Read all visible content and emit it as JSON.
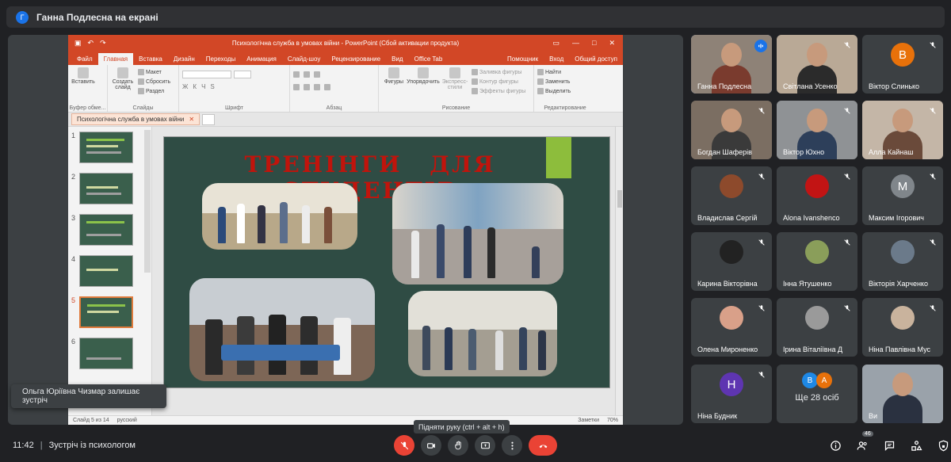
{
  "presenter_bar": {
    "avatar_letter": "Г",
    "text": "Ганна Подлесна на екрані"
  },
  "colors": {
    "accent_blue": "#1a73e8",
    "end_call_red": "#ea4335",
    "ppt_orange": "#d24726",
    "slide_green": "#2f4c44",
    "title_red": "#c0140c"
  },
  "powerpoint": {
    "window_title": "Психологічна служба в умовах війни - PowerPoint (Сбой активации продукта)",
    "tabs": [
      "Файл",
      "Главная",
      "Вставка",
      "Дизайн",
      "Переходы",
      "Анимация",
      "Слайд-шоу",
      "Рецензирование",
      "Вид",
      "Office Tab"
    ],
    "tab_right": {
      "help": "Помощник",
      "signin": "Вход",
      "share": "Общий доступ"
    },
    "ribbon": {
      "paste": "Вставить",
      "clipboard_group": "Буфер обме...",
      "new_slide": "Создать слайд",
      "layout": "Макет",
      "reset": "Сбросить",
      "section": "Раздел",
      "slides_group": "Слайды",
      "font_group": "Шрифт",
      "paragraph_group": "Абзац",
      "shapes": "Фигуры",
      "arrange": "Упорядочить",
      "quick_styles": "Экспресс-стили",
      "fill": "Заливка фигуры",
      "outline": "Контур фигуры",
      "effects": "Эффекты фигуры",
      "drawing_group": "Рисование",
      "find": "Найти",
      "replace": "Заменить",
      "select": "Выделить",
      "editing_group": "Редактирование"
    },
    "doc_tab": "Психологічна служба в умовах війни",
    "slide_numbers": [
      "1",
      "2",
      "3",
      "4",
      "5",
      "6"
    ],
    "current_slide": "5",
    "slide_heading": "ТРЕНІНГИ ДЛЯ СТУДЕНТІВ",
    "status": {
      "slide_pos": "Слайд 5 из 14",
      "language": "русский",
      "notes": "Заметки",
      "zoom": "70%"
    }
  },
  "toast": "Ольга Юріївна Чизмар залишає зустріч",
  "tooltip": "Підняти руку (ctrl + alt + h)",
  "participants": [
    {
      "name": "Ганна Подлесна",
      "kind": "video",
      "speaking": true
    },
    {
      "name": "Світлана Усенко",
      "kind": "video"
    },
    {
      "name": "Віктор Слинько",
      "kind": "letter",
      "letter": "В",
      "color": "#e8710a"
    },
    {
      "name": "Богдан Шаферів",
      "kind": "video"
    },
    {
      "name": "Віктор Юхно",
      "kind": "video"
    },
    {
      "name": "Алла Кайнаш",
      "kind": "video"
    },
    {
      "name": "Владислав Сергій",
      "kind": "photo",
      "color": "#8d4a2c"
    },
    {
      "name": "Alona Ivanshenco",
      "kind": "photo",
      "color": "#c21414"
    },
    {
      "name": "Максим Ігорович",
      "kind": "letter",
      "letter": "М",
      "color": "#80868b"
    },
    {
      "name": "Карина Вікторівна",
      "kind": "photo",
      "color": "#222222"
    },
    {
      "name": "Інна Ятушенко",
      "kind": "photo",
      "color": "#8a9e5a"
    },
    {
      "name": "Вікторія Харченко",
      "kind": "photo",
      "color": "#6b7a8a"
    },
    {
      "name": "Олена Мироненко",
      "kind": "photo",
      "color": "#d9a089"
    },
    {
      "name": "Ірина Віталіївна Д",
      "kind": "photo",
      "color": "#9a9a9a"
    },
    {
      "name": "Ніна Павлівна Мус",
      "kind": "photo",
      "color": "#c9b39d"
    },
    {
      "name": "Ніна Будник",
      "kind": "letter",
      "letter": "Н",
      "color": "#5e35b1"
    },
    {
      "name": "Ще 28 осіб",
      "kind": "more",
      "letters": [
        "В",
        "А"
      ]
    },
    {
      "name": "Ви",
      "kind": "video"
    }
  ],
  "bottom_bar": {
    "time": "11:42",
    "meeting_title": "Зустріч із психологом",
    "participant_count": "46"
  }
}
